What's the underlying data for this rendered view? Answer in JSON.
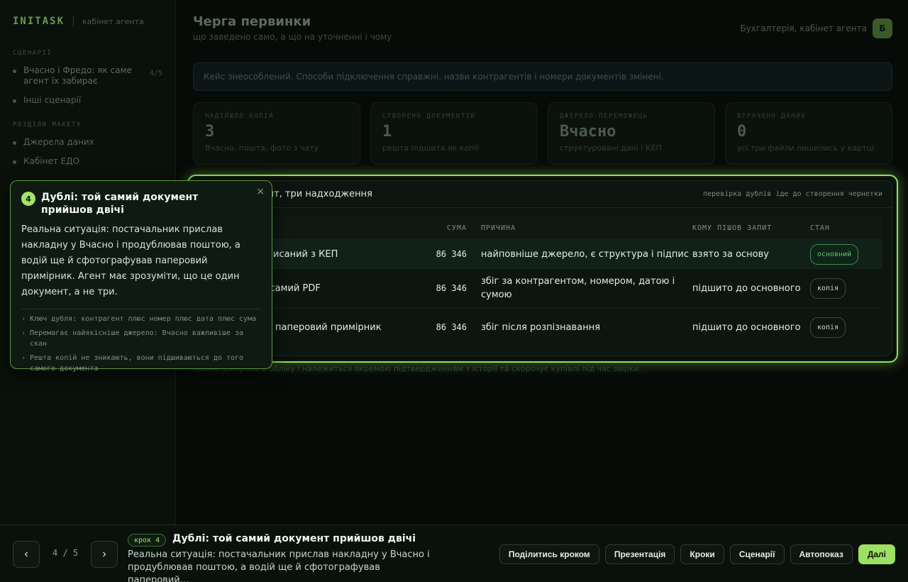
{
  "sidebar": {
    "brand": "INITASK",
    "brand_sub": "кабінет агента",
    "section_scenarios": "СЦЕНАРІЇ",
    "scenarios": [
      {
        "label": "Вчасно і Фредо: як саме агент їх забирає",
        "count": "4/5"
      },
      {
        "label": "Інші сценарії",
        "count": ""
      }
    ],
    "section_demo": "РОЗДІЛИ МАКЕТУ",
    "demo_items": [
      {
        "label": "Джерела даних"
      },
      {
        "label": "Кабінет ЕДО"
      }
    ]
  },
  "header": {
    "title": "Черга первинки",
    "subtitle": "що заведено само, а що на уточненні і чому",
    "account": "Бухгалтерія, кабінет агента",
    "avatar": "Б"
  },
  "notice": "Кейс знеособлений. Способи підключення справжні, назви контрагентів і номери документів змінені.",
  "stats": [
    {
      "label": "НАДІЙШЛО КОПІЙ",
      "value": "3",
      "caption": "Вчасно, пошта, фото з чату"
    },
    {
      "label": "СТВОРЕНО ДОКУМЕНТІВ",
      "value": "1",
      "caption": "решта підшита як копії"
    },
    {
      "label": "ДЖЕРЕЛО-ПЕРЕМОЖЕЦЬ",
      "value": "Вчасно",
      "caption": "структуровані дані і КЕП"
    },
    {
      "label": "ВТРАЧЕНО ДАНИХ",
      "value": "0",
      "caption": "усі три файли лишились у картці"
    }
  ],
  "panel": {
    "title": "Один документ, три надходження",
    "note": "перевірка дублів іде до створення чернетки",
    "columns": [
      "ДОКУМЕНТ",
      "СУМА",
      "ПРИЧИНА",
      "КОМУ ПІШОВ ЗАПИТ",
      "СТАН"
    ],
    "rows": [
      {
        "doc": "Вчасно, підписаний з КЕП",
        "sum": "86 346",
        "reason": "найповніше джерело, є структура і підпис",
        "who": "взято за основу",
        "state": "основний"
      },
      {
        "doc": "Пошта, той самий PDF",
        "sum": "86 346",
        "reason": "збіг за контрагентом, номером, датою і сумою",
        "who": "підшито до основного",
        "state": "копія"
      },
      {
        "doc": "Фото з чату, паперовий примірник",
        "sum": "86 346",
        "reason": "збіг після розпізнавання",
        "who": "підшито до основного",
        "state": "копія"
      }
    ],
    "footnote": "Кожне джерело в обліку і належиться окремою підтвердженням з історії та скорочує купівлі під час звірки."
  },
  "tooltip": {
    "number": "4",
    "title": "Дублі: той самий документ прийшов двічі",
    "body": "Реальна ситуація: постачальник прислав накладну у Вчасно і продублював поштою, а водій ще й сфотографував паперовий примірник. Агент має зрозуміти, що це один документ, а не три.",
    "close": "×",
    "points": [
      "Ключ дубля: контрагент плюс номер плюс дата плюс сума",
      "Перемагає найякісніше джерело: Вчасно важливіше за скан",
      "Решта копій не зникають, вони підшиваються до того самого документа"
    ]
  },
  "bottombar": {
    "prev": "‹",
    "next": "›",
    "counter": "4 / 5",
    "step_pill": "крок 4",
    "step_title": "Дублі: той самий документ прийшов двічі",
    "step_desc": "Реальна ситуація: постачальник прислав накладну у Вчасно і продублював поштою, а водій ще й сфотографував паперовий…",
    "actions": {
      "share": "Поділитись кроком",
      "present": "Презентація",
      "steps": "Кроки",
      "scenarios": "Сценарії",
      "autoplay": "Автопоказ",
      "next": "Далі"
    }
  },
  "colors": {
    "accent": "#9ee063",
    "background": "#070b08",
    "primary_badge": "#62c27a"
  }
}
